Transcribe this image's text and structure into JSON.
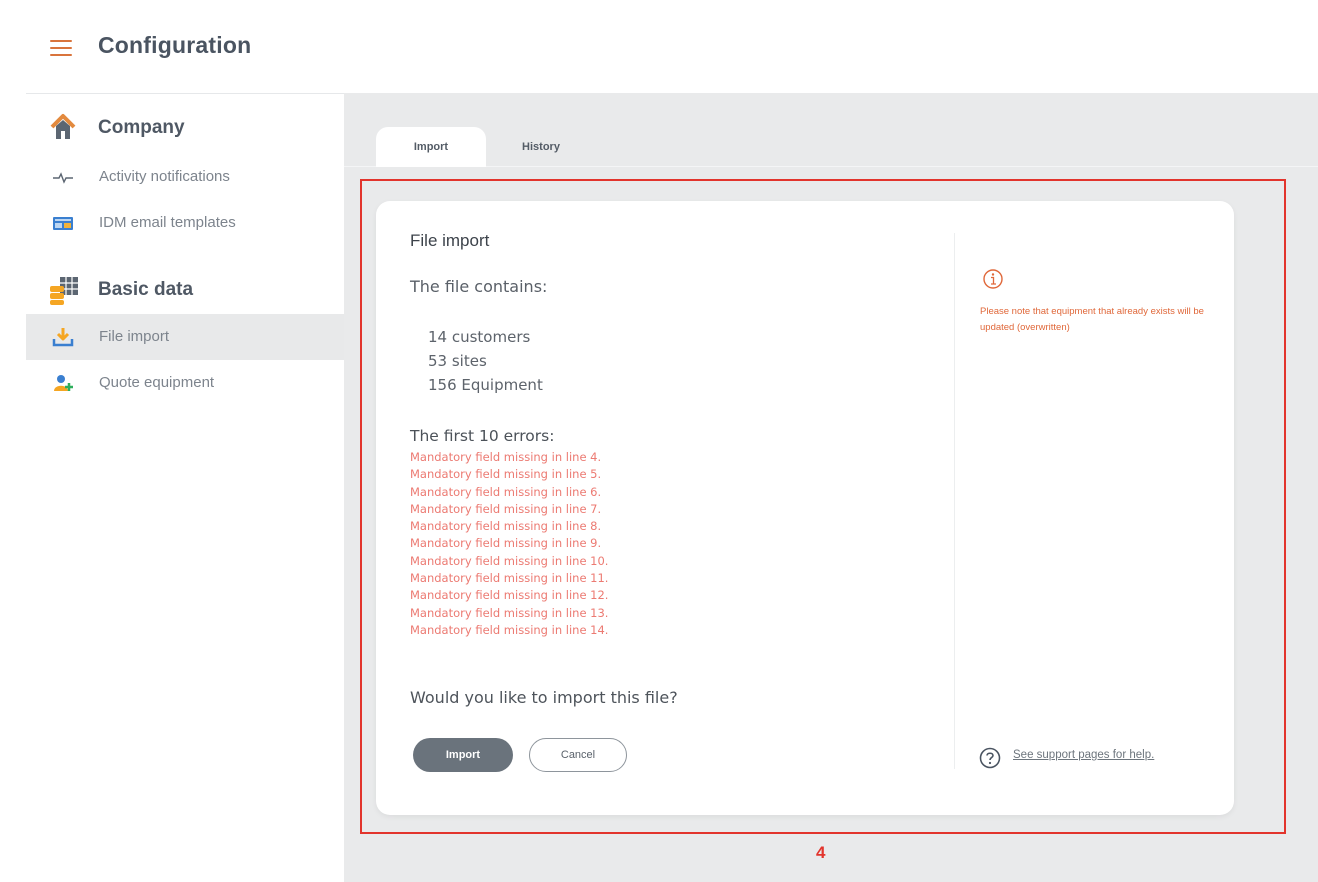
{
  "header": {
    "title": "Configuration",
    "menu_icon": "hamburger-icon"
  },
  "sidebar": {
    "sections": [
      {
        "label": "Company",
        "icon": "house-icon",
        "items": [
          {
            "label": "Activity notifications",
            "icon": "pulse-icon"
          },
          {
            "label": "IDM email templates",
            "icon": "email-template-icon"
          }
        ]
      },
      {
        "label": "Basic data",
        "icon": "data-table-icon",
        "items": [
          {
            "label": "File import",
            "icon": "download-icon",
            "active": true
          },
          {
            "label": "Quote equipment",
            "icon": "user-add-icon"
          }
        ]
      }
    ]
  },
  "tabs": [
    {
      "label": "Import",
      "active": true
    },
    {
      "label": "History",
      "active": false
    }
  ],
  "annotation": {
    "step_number": "4"
  },
  "file_import": {
    "title": "File import",
    "contains_label": "The file contains:",
    "counts": [
      "14 customers",
      "53 sites",
      "156 Equipment"
    ],
    "errors_title": "The first 10 errors:",
    "errors": [
      "Mandatory field missing in line 4.",
      "Mandatory field missing in line 5.",
      "Mandatory field missing in line 6.",
      "Mandatory field missing in line 7.",
      "Mandatory field missing in line 8.",
      "Mandatory field missing in line 9.",
      "Mandatory field missing in line 10.",
      "Mandatory field missing in line 11.",
      "Mandatory field missing in line 12.",
      "Mandatory field missing in line 13.",
      "Mandatory field missing in line 14."
    ],
    "question": "Would you like to import this file?",
    "import_button": "Import",
    "cancel_button": "Cancel"
  },
  "info_panel": {
    "note_icon": "info-icon",
    "note": "Please note that equipment that already exists will be updated (overwritten)",
    "help_icon": "question-circle-icon",
    "help_link": "See support pages for help."
  },
  "colors": {
    "accent": "#d9743c",
    "error": "#ec7a72",
    "warning": "#e0683a",
    "highlight": "#e2342c",
    "primary_button": "#6a737c"
  }
}
